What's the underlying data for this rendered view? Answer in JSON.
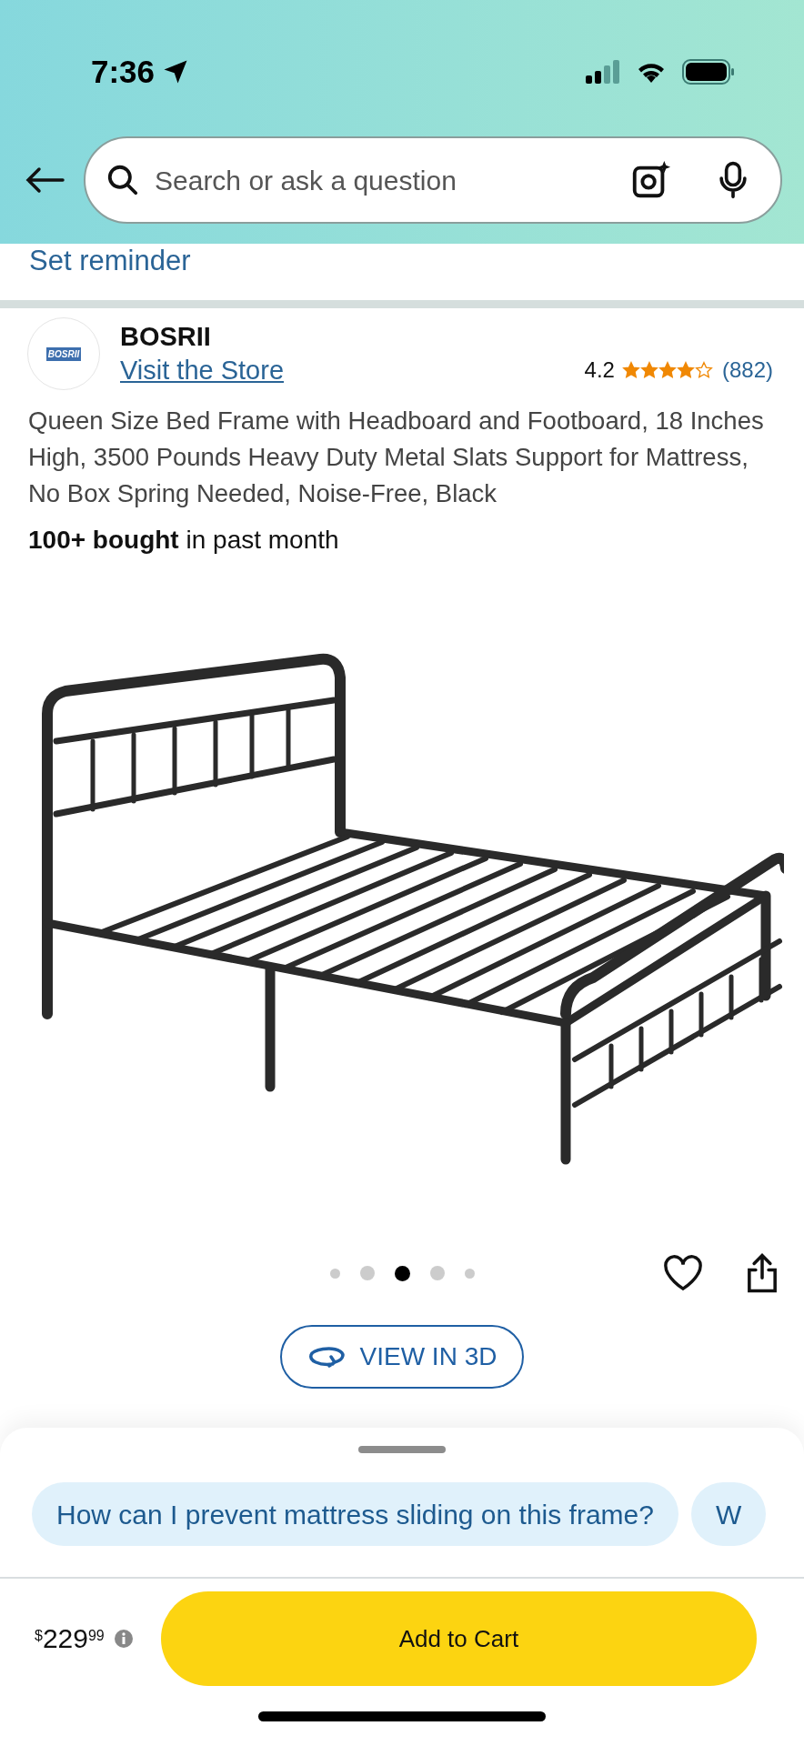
{
  "status_bar": {
    "time": "7:36"
  },
  "search": {
    "placeholder": "Search or ask a question"
  },
  "reminder_link": "Set reminder",
  "store": {
    "logo_text": "BOSRII",
    "name": "BOSRII",
    "link": "Visit the Store",
    "rating": "4.2",
    "stars": 4,
    "review_count": "(882)"
  },
  "product": {
    "title": "Queen Size Bed Frame with Headboard and Footboard, 18 Inches High, 3500 Pounds Heavy Duty Metal Slats Support for Mattress, No Box Spring Needed, Noise-Free, Black",
    "bought": "**100+ bought** in past month"
  },
  "image_dots": [
    {
      "selected": false
    },
    {
      "selected": false
    },
    {
      "selected": true
    },
    {
      "selected": false
    },
    {
      "selected": false
    }
  ],
  "view_3d_button": "VIEW IN 3D",
  "question_chips": [
    "How can I prevent mattress sliding on this frame?",
    "W"
  ],
  "price": {
    "currency": "$",
    "whole": "229",
    "fraction": "99"
  },
  "add_to_cart_button": "Add to Cart"
}
